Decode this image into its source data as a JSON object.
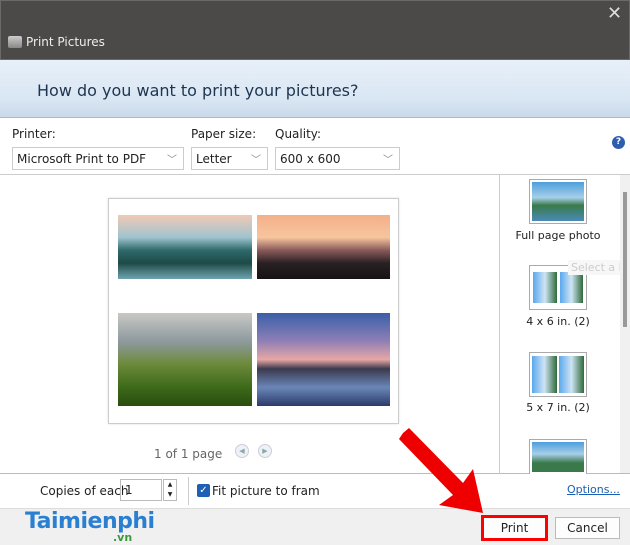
{
  "window": {
    "title": "Print Pictures",
    "close": "✕"
  },
  "header": {
    "heading": "How do you want to print your pictures?"
  },
  "controls": {
    "printer": {
      "label": "Printer:",
      "value": "Microsoft Print to PDF"
    },
    "paper_size": {
      "label": "Paper size:",
      "value": "Letter"
    },
    "quality": {
      "label": "Quality:",
      "value": "600 x 600"
    },
    "help": "?"
  },
  "preview": {
    "page_status": "1 of 1 page",
    "prev": "◀",
    "next": "▶"
  },
  "layouts": {
    "items": [
      {
        "label": "Full page photo"
      },
      {
        "label": "4 x 6 in. (2)"
      },
      {
        "label": "5 x 7 in. (2)"
      }
    ],
    "tooltip": "Select a lay"
  },
  "bottom": {
    "copies_label": "Copies of each",
    "copies_value": "1",
    "fit_label": "Fit picture to fram",
    "options_link": "Options..."
  },
  "footer": {
    "print": "Print",
    "cancel": "Cancel",
    "logo": "Taimienphi",
    "logo_sub": ".vn"
  },
  "colors": {
    "titlebar": "#4b4a48",
    "highlight": "#ff0000",
    "link": "#1a5fb4"
  }
}
